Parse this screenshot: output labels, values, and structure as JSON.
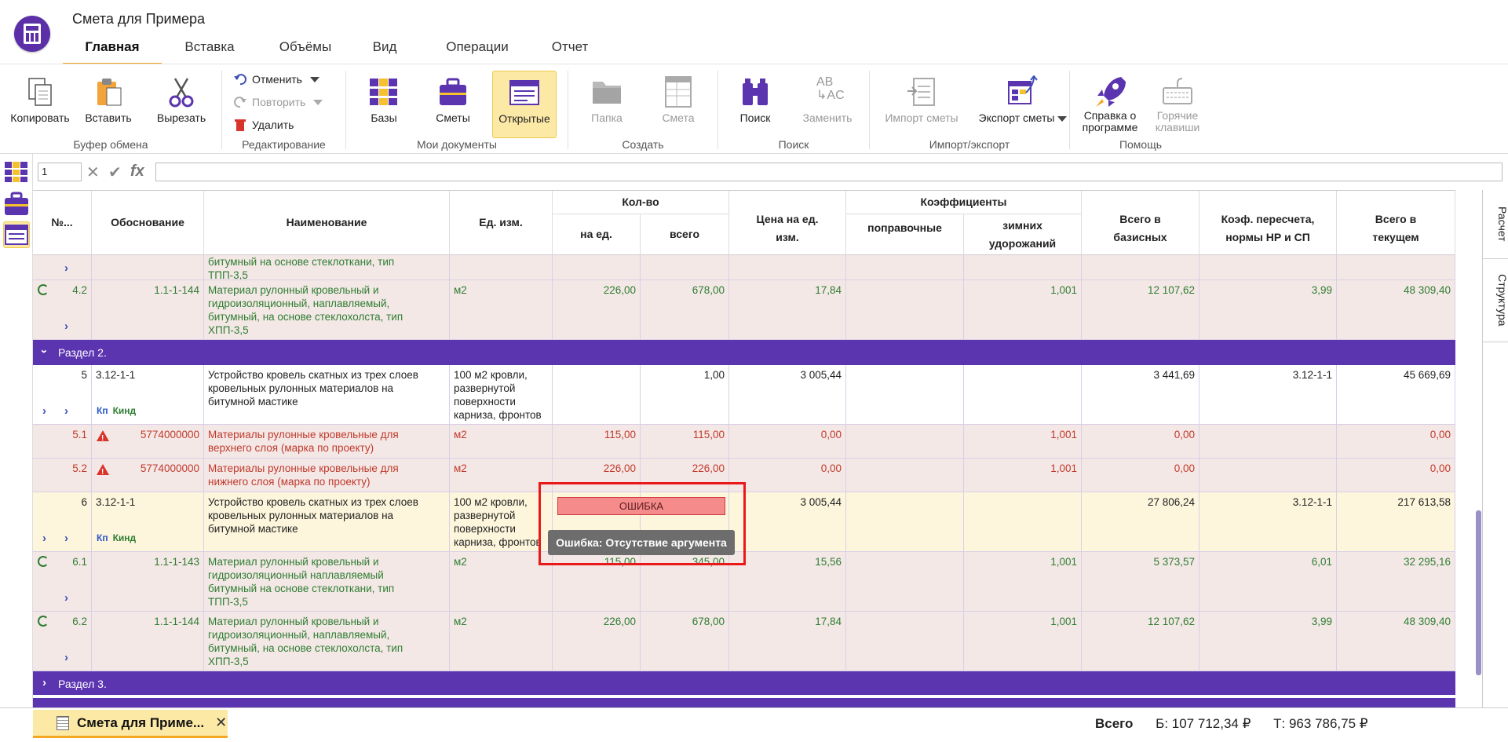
{
  "window": {
    "title": "Смета для Примера"
  },
  "menu_tabs": [
    {
      "label": "Главная",
      "active": true
    },
    {
      "label": "Вставка"
    },
    {
      "label": "Объёмы"
    },
    {
      "label": "Вид"
    },
    {
      "label": "Операции"
    },
    {
      "label": "Отчет"
    }
  ],
  "ribbon": {
    "clipboard": {
      "label": "Буфер обмена",
      "copy": "Копировать",
      "paste": "Вставить",
      "cut": "Вырезать"
    },
    "edit": {
      "label": "Редактирование",
      "undo": "Отменить",
      "redo": "Повторить",
      "delete": "Удалить"
    },
    "docs": {
      "label": "Мои документы",
      "bases": "Базы",
      "estimates": "Сметы",
      "opened": "Открытые"
    },
    "create": {
      "label": "Создать",
      "folder": "Папка",
      "estimate": "Смета"
    },
    "search": {
      "label": "Поиск",
      "find": "Поиск",
      "replace": "Заменить"
    },
    "io": {
      "label": "Импорт/экспорт",
      "import": "Импорт сметы",
      "export": "Экспорт сметы"
    },
    "help": {
      "label": "Помощь",
      "about_1": "Справка о",
      "about_2": "программе",
      "hotkeys_1": "Горячие",
      "hotkeys_2": "клавиши"
    }
  },
  "formula": {
    "cell_ref": "1",
    "fx": "fx"
  },
  "grid_headers": {
    "num": "№...",
    "basis": "Обоснование",
    "name": "Наименование",
    "unit": "Ед. изм.",
    "qty": "Кол-во",
    "qty_per": "на ед.",
    "qty_total": "всего",
    "price_1": "Цена на ед.",
    "price_2": "изм.",
    "coef": "Коэффициенты",
    "coef_corr": "поправочные",
    "coef_winter_1": "зимних",
    "coef_winter_2": "удорожаний",
    "base_1": "Всего в",
    "base_2": "базисных",
    "recalc_1": "Коэф. пересчета,",
    "recalc_2": "нормы НР и СП",
    "current_1": "Всего в",
    "current_2": "текущем"
  },
  "rows": {
    "r0": {
      "name_1": "битумный на основе стеклоткани, тип",
      "name_2": "ТПП-3,5"
    },
    "r42": {
      "num": "4.2",
      "basis": "1.1-1-144",
      "name_1": "Материал рулонный кровельный и",
      "name_2": "гидроизоляционный, наплавляемый,",
      "name_3": "битумный, на основе стеклохолста, тип",
      "name_4": "ХПП-3,5",
      "unit": "м2",
      "qty_per": "226,00",
      "qty_total": "678,00",
      "price": "17,84",
      "winter": "1,001",
      "base": "12 107,62",
      "recalc": "3,99",
      "current": "48 309,40"
    },
    "sec2": {
      "title": "Раздел 2."
    },
    "r5": {
      "num": "5",
      "basis": "3.12-1-1",
      "name_1": "Устройство кровель скатных из трех слоев",
      "name_2": "кровельных рулонных материалов на",
      "name_3": "битумной мастике",
      "unit_1": "100 м2 кровли,",
      "unit_2": "развернутой",
      "unit_3": "поверхности",
      "unit_4": "карниза, фронтов",
      "qty_total": "1,00",
      "price": "3 005,44",
      "base": "3 441,69",
      "recalc": "3.12-1-1",
      "current": "45 669,69",
      "kp": "Кп",
      "kind": "Кинд"
    },
    "r51": {
      "num": "5.1",
      "basis": "5774000000",
      "name_1": "Материалы рулонные кровельные для",
      "name_2": "верхнего слоя (марка по проекту)",
      "unit": "м2",
      "qty_per": "115,00",
      "qty_total": "115,00",
      "price": "0,00",
      "winter": "1,001",
      "base": "0,00",
      "current": "0,00"
    },
    "r52": {
      "num": "5.2",
      "basis": "5774000000",
      "name_1": "Материалы рулонные кровельные для",
      "name_2": "нижнего слоя (марка по проекту)",
      "unit": "м2",
      "qty_per": "226,00",
      "qty_total": "226,00",
      "price": "0,00",
      "winter": "1,001",
      "base": "0,00",
      "current": "0,00"
    },
    "r6": {
      "num": "6",
      "basis": "3.12-1-1",
      "name_1": "Устройство кровель скатных из трех слоев",
      "name_2": "кровельных рулонных материалов на",
      "name_3": "битумной мастике",
      "unit_1": "100 м2 кровли,",
      "unit_2": "развернутой",
      "unit_3": "поверхности",
      "unit_4": "карниза, фронтов",
      "price": "3 005,44",
      "base": "27 806,24",
      "recalc": "3.12-1-1",
      "current": "217 613,58",
      "kp": "Кп",
      "kind": "Кинд"
    },
    "r61": {
      "num": "6.1",
      "basis": "1.1-1-143",
      "name_1": "Материал рулонный кровельный и",
      "name_2": "гидроизоляционный наплавляемый",
      "name_3": "битумный на основе стеклоткани, тип",
      "name_4": "ТПП-3,5",
      "unit": "м2",
      "qty_per": "115,00",
      "qty_total": "345,00",
      "price": "15,56",
      "winter": "1,001",
      "base": "5 373,57",
      "recalc": "6,01",
      "current": "32 295,16"
    },
    "r62": {
      "num": "6.2",
      "basis": "1.1-1-144",
      "name_1": "Материал рулонный кровельный и",
      "name_2": "гидроизоляционный, наплавляемый,",
      "name_3": "битумный, на основе стеклохолста, тип",
      "name_4": "ХПП-3,5",
      "unit": "м2",
      "qty_per": "226,00",
      "qty_total": "678,00",
      "price": "17,84",
      "winter": "1,001",
      "base": "12 107,62",
      "recalc": "3,99",
      "current": "48 309,40"
    },
    "sec3": {
      "title": "Раздел 3."
    }
  },
  "error": {
    "cell_text": "ОШИБКА",
    "tooltip": "Ошибка: Отсутствие аргумента"
  },
  "side_tabs": {
    "calc": "Расчет",
    "structure": "Структура"
  },
  "bottom": {
    "doc_tab": "Смета для Приме...",
    "close": "✕",
    "total_label": "Всего",
    "total_base": "Б: 107 712,34 ₽",
    "total_current": "Т: 963 786,75 ₽"
  },
  "colors": {
    "accent": "#5b34b0",
    "tab_active": "#f5a623",
    "error": "#e8181b",
    "green_text": "#2e7d32",
    "red_text": "#c0392b"
  }
}
